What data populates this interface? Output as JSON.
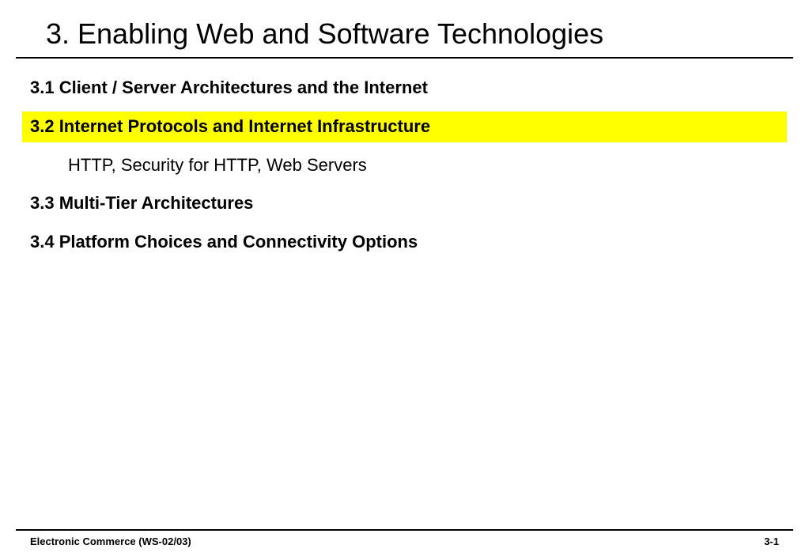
{
  "title": "3. Enabling Web and Software Technologies",
  "sections": {
    "s1": "3.1 Client / Server Architectures and the Internet",
    "s2": "3.2 Internet Protocols and Internet Infrastructure",
    "s2_sub": "HTTP, Security for HTTP, Web Servers",
    "s3": "3.3 Multi-Tier Architectures",
    "s4": "3.4 Platform Choices and Connectivity Options"
  },
  "footer": {
    "left": "Electronic Commerce (WS-02/03)",
    "right": "3-1"
  }
}
